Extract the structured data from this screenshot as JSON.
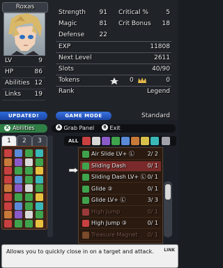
{
  "character": {
    "name": "Roxas",
    "stats_left": [
      {
        "label": "LV",
        "value": "9"
      },
      {
        "label": "HP",
        "value": "86"
      },
      {
        "label": "Abilities",
        "value": "12"
      },
      {
        "label": "Links",
        "value": "19"
      }
    ]
  },
  "stats": {
    "strength": {
      "label": "Strength",
      "value": "91"
    },
    "critical": {
      "label": "Critical %",
      "value": "5"
    },
    "magic": {
      "label": "Magic",
      "value": "81"
    },
    "crit_bonus": {
      "label": "Crit Bonus",
      "value": "18"
    },
    "defense": {
      "label": "Defense",
      "value": "22"
    },
    "exp": {
      "label": "EXP",
      "value": "11808"
    },
    "next_level": {
      "label": "Next Level",
      "value": "2611"
    },
    "slots": {
      "label": "Slots",
      "value": "40/90"
    },
    "tokens": {
      "label": "Tokens",
      "value_a": "0",
      "value_b": "0"
    },
    "rank": {
      "label": "Rank",
      "value": "Legend"
    }
  },
  "badges": {
    "updated": "UPDATED!",
    "game_mode_label": "GAME MODE",
    "game_mode_value": "Standard"
  },
  "bottom": {
    "abilities_tab": "Abilities",
    "abilities_glyph": "X",
    "grab_glyph": "A",
    "grab_label": "Grab Panel",
    "exit_glyph": "B",
    "exit_label": "Exit",
    "deck_tabs": [
      "1",
      "2",
      "3"
    ],
    "filter_all": "ALL",
    "abilities": [
      {
        "name": "Air Slide LV+ Ⓛ",
        "value": "2/ 2",
        "selected": false,
        "dim": false,
        "icon_color": "#3fa34d"
      },
      {
        "name": "Sliding Dash",
        "value": "0/ 1",
        "selected": true,
        "dim": false,
        "icon_color": "#3fa34d"
      },
      {
        "name": "Sliding Dash LV+ Ⓛ",
        "value": "0/ 1",
        "selected": false,
        "dim": false,
        "icon_color": "#3fa34d"
      },
      {
        "name": "Glide ③",
        "value": "0/ 1",
        "selected": false,
        "dim": false,
        "icon_color": "#3fa34d"
      },
      {
        "name": "Glide LV+ Ⓛ",
        "value": "3/ 3",
        "selected": false,
        "dim": false,
        "icon_color": "#3fa34d"
      },
      {
        "name": "High Jump",
        "value": "0/ 1",
        "selected": false,
        "dim": true,
        "icon_color": "#9a3a3a"
      },
      {
        "name": "High Jump ③",
        "value": "0/ 1",
        "selected": false,
        "dim": false,
        "icon_color": "#c84040"
      },
      {
        "name": "Treasure Magnet",
        "value": "0/ 1",
        "selected": false,
        "dim": true,
        "icon_color": "#7a4a2a"
      }
    ],
    "description": "Allows you to quickly close in on a target and attack.",
    "link_badge": "LINK"
  }
}
